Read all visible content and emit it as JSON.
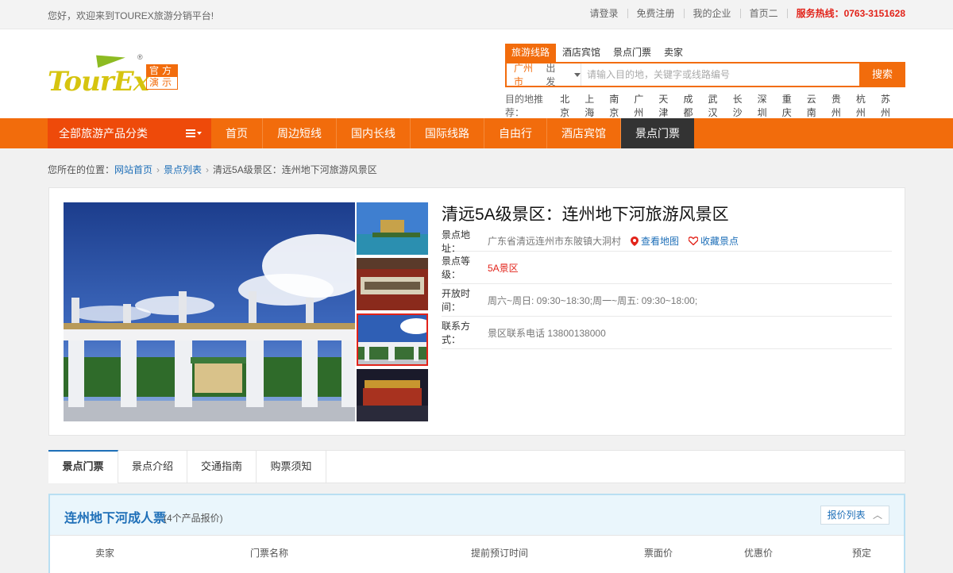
{
  "topbar": {
    "welcome": "您好，欢迎来到TOUREX旅游分销平台!",
    "links": [
      "请登录",
      "免费注册",
      "我的企业",
      "首页二"
    ],
    "hotline": "服务热线：0763-3151628"
  },
  "logo": {
    "text": "TourEx",
    "badge_line1": "官方",
    "badge_line2": "演示",
    "reg": "®"
  },
  "search": {
    "tabs": [
      "旅游线路",
      "酒店宾馆",
      "景点门票",
      "卖家"
    ],
    "active_tab": 0,
    "city": "广州市",
    "depart": "出发",
    "placeholder": "请输入目的地，关键字或线路编号",
    "button": "搜索",
    "hot_label": "目的地推荐：",
    "hot_destinations": [
      "北京",
      "上海",
      "南京",
      "广州",
      "天津",
      "成都",
      "武汉",
      "长沙",
      "深圳",
      "重庆",
      "云南",
      "贵州",
      "杭州",
      "苏州"
    ]
  },
  "nav": {
    "all_label": "全部旅游产品分类",
    "items": [
      "首页",
      "周边短线",
      "国内长线",
      "国际线路",
      "自由行",
      "酒店宾馆",
      "景点门票"
    ],
    "active_index": 6
  },
  "breadcrumb": {
    "prefix": "您所在的位置：",
    "items": [
      "网站首页",
      "景点列表",
      "清远5A级景区：连州地下河旅游风景区"
    ]
  },
  "attraction": {
    "title": "清远5A级景区：连州地下河旅游风景区",
    "address_label": "景点地址：",
    "address": "广东省清远连州市东陂镇大洞村",
    "map_link": "查看地图",
    "fav_link": "收藏景点",
    "level_label": "景点等级：",
    "level": "5A景区",
    "hours_label": "开放时间：",
    "hours": "周六~周日: 09:30~18:30;周一~周五: 09:30~18:00;",
    "contact_label": "联系方式：",
    "contact": "景区联系电话 13800138000",
    "thumb_active": 2
  },
  "tabs": {
    "items": [
      "景点门票",
      "景点介绍",
      "交通指南",
      "购票须知"
    ],
    "active": 0
  },
  "tickets": {
    "title": "连州地下河成人票",
    "count": "(4个产品报价)",
    "price_list_btn": "报价列表",
    "columns": [
      "卖家",
      "门票名称",
      "提前预订时间",
      "票面价",
      "优惠价",
      "预定"
    ]
  },
  "colors": {
    "brand_orange": "#f26c0c",
    "nav_active": "#333333",
    "link_blue": "#1e6fb8",
    "hot_red": "#e2231a"
  }
}
